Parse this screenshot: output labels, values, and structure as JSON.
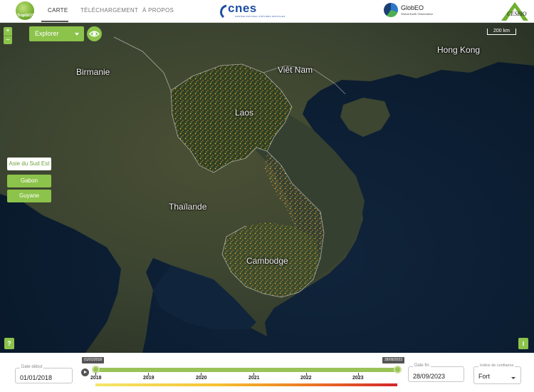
{
  "header": {
    "left_logo_text": "TropiSCO",
    "nav": [
      {
        "label": "CARTE",
        "active": true
      },
      {
        "label": "TÉLÉCHARGEMENT",
        "active": false
      },
      {
        "label": "À PROPOS",
        "active": false
      }
    ],
    "cnes_name": "cnes",
    "cnes_subtitle": "CENTRE NATIONAL D'ÉTUDES SPATIALES",
    "globeo_name": "GlobEO",
    "globeo_subtitle": "Global Earth Observation",
    "cesbio_name": "CESBIO"
  },
  "map": {
    "zoom_in": "+",
    "zoom_out": "−",
    "layer_select": "Explorer",
    "scale_label": "200 km",
    "labels": {
      "birmanie": "Birmanie",
      "vietnam": "Viêt Nam",
      "hongkong": "Hong Kong",
      "laos": "Laos",
      "thailande": "Thaïlande",
      "cambodge": "Cambodge"
    },
    "regions": [
      {
        "label": "Asie du Sud Est",
        "active": true
      },
      {
        "label": "Gabon",
        "active": false
      },
      {
        "label": "Guyane",
        "active": false
      }
    ],
    "help": "?",
    "info": "i",
    "colors": {
      "accent": "#8cc34b",
      "sea": "#0c1e33",
      "land": "#3c4631"
    }
  },
  "timeline": {
    "start_label": "Date début",
    "start_value": "01/01/2018",
    "end_label": "Date fin",
    "end_value": "28/09/2023",
    "start_tip": "01/01/2018",
    "end_tip": "28/09/2023",
    "years": [
      "2018",
      "2019",
      "2020",
      "2021",
      "2022",
      "2023"
    ],
    "confidence_label": "Indice de confiance",
    "confidence_value": "Fort"
  }
}
